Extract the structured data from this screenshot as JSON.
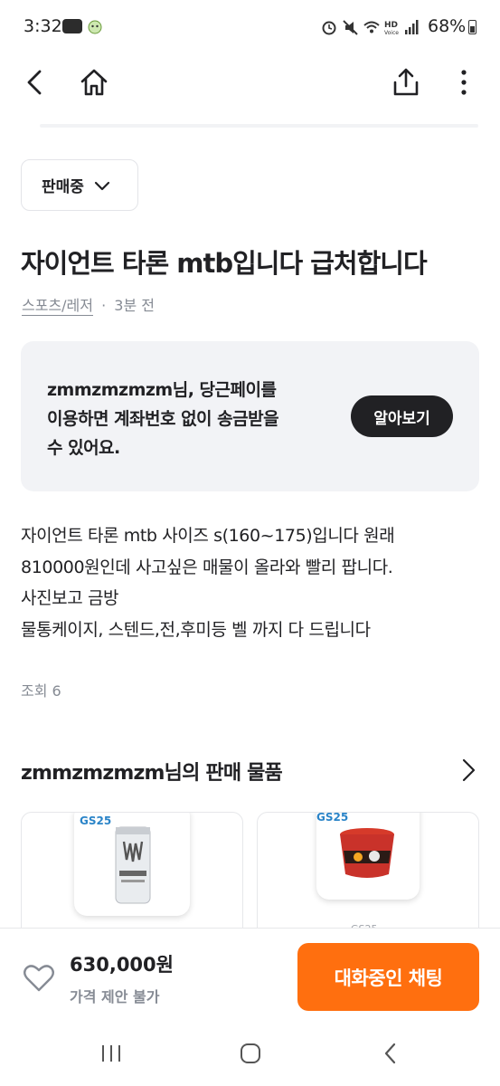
{
  "status_bar": {
    "time": "3:32",
    "battery": "68%",
    "icons": [
      "alarm-icon",
      "mute-icon",
      "wifi-icon",
      "hd-voice-icon",
      "signal-icon",
      "battery-icon"
    ]
  },
  "app_bar": {
    "icons": [
      "back-icon",
      "home-icon",
      "share-icon",
      "more-icon"
    ]
  },
  "listing": {
    "status": "판매중",
    "title": "자이언트 타론 mtb입니다 급처합니다",
    "category": "스포츠/레저",
    "separator": "·",
    "time_ago": "3분 전",
    "description_lines": [
      "자이언트 타론 mtb 사이즈 s(160~175)입니다 원래",
      "810000원인데  사고싶은 매물이 올라와 빨리 팝니다.",
      "사진보고 금방",
      "물통케이지, 스텐드,전,후미등 벨 까지 다 드립니다"
    ],
    "views": "조회 6"
  },
  "pay_banner": {
    "text": "zmmzmzmzm님, 당근페이를\n이용하면 계좌번호 없이 송금받을\n수 있어요.",
    "button": "알아보기"
  },
  "seller_items": {
    "title": "zmmzmzmzm님의 판매 물품",
    "cards": [
      {
        "badge": "GS25",
        "store": ""
      },
      {
        "badge": "GS25",
        "store": "GS25"
      }
    ]
  },
  "bottom_bar": {
    "price": "630,000원",
    "price_note": "가격 제안 불가",
    "chat_button": "대화중인 채팅"
  },
  "colors": {
    "accent": "#ff6f0f",
    "dark": "#212124",
    "muted": "#868b94",
    "banner_bg": "#f2f3f6"
  }
}
